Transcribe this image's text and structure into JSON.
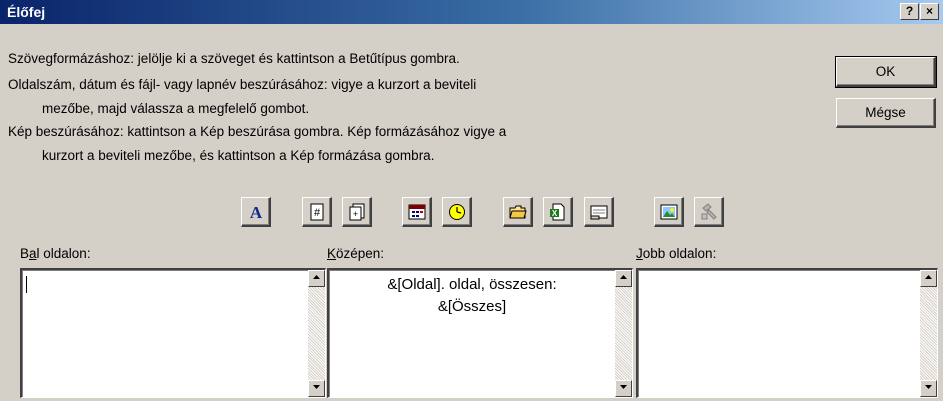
{
  "window": {
    "title": "Élőfej",
    "help_label": "?",
    "close_label": "×"
  },
  "instructions": [
    "Szövegformázáshoz: jelölje ki a szöveget és kattintson a Betűtípus gombra.",
    "Oldalszám, dátum és fájl- vagy lapnév beszúrásához: vigye a kurzort a beviteli",
    "mezőbe, majd válassza a megfelelő gombot.",
    "Kép beszúrásához: kattintson a Kép beszúrása gombra.  Kép formázásához vigye a",
    "kurzort a beviteli mezőbe, és kattintson a Kép formázása gombra."
  ],
  "buttons": {
    "ok": "OK",
    "cancel": "Mégse"
  },
  "toolbar": [
    {
      "name": "font",
      "icon": "font-A-icon"
    },
    {
      "name": "page-number",
      "icon": "page-number-icon"
    },
    {
      "name": "total-pages",
      "icon": "total-pages-icon"
    },
    {
      "name": "date",
      "icon": "date-icon"
    },
    {
      "name": "time",
      "icon": "clock-icon"
    },
    {
      "name": "file-path",
      "icon": "folder-icon"
    },
    {
      "name": "file-name",
      "icon": "excel-file-icon"
    },
    {
      "name": "sheet-name",
      "icon": "sheet-tab-icon"
    },
    {
      "name": "insert-picture",
      "icon": "picture-icon"
    },
    {
      "name": "format-picture",
      "icon": "format-picture-icon"
    }
  ],
  "sections": {
    "left": {
      "label_pre": "B",
      "label_key": "a",
      "label_post": "l oldalon:",
      "value": ""
    },
    "center": {
      "label_pre": "",
      "label_key": "K",
      "label_post": "özépen:",
      "value_line1": "&[Oldal]. oldal, összesen:",
      "value_line2": "&[Összes]"
    },
    "right": {
      "label_pre": "",
      "label_key": "J",
      "label_post": "obb oldalon:",
      "value": ""
    }
  },
  "colors": {
    "dialog_bg": "#d4d0c8",
    "title_gradient_start": "#0a246a",
    "title_gradient_end": "#a6caf0"
  }
}
